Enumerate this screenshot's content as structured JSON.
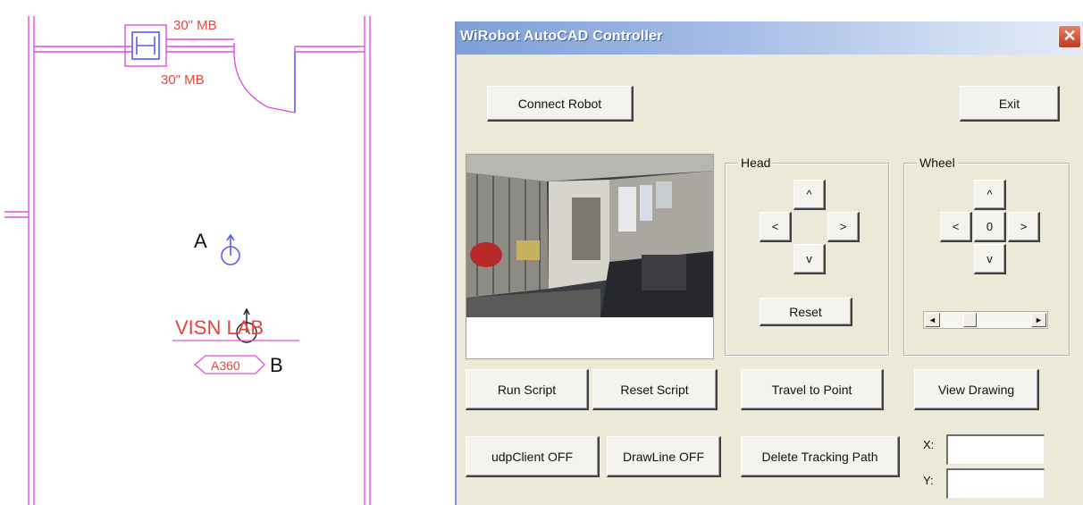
{
  "cad": {
    "mb_top": "30\" MB",
    "mb_bottom": "30\" MB",
    "point_a": "A",
    "point_b": "B",
    "room_name": "VISN LAB",
    "room_number": "A360",
    "wall_color": "#e04ee0",
    "marker_color": "#5a5af0"
  },
  "window": {
    "title": "WiRobot AutoCAD Controller",
    "close_glyph": "✕"
  },
  "buttons": {
    "connect": "Connect Robot",
    "exit": "Exit",
    "head_up": "^",
    "head_left": "<",
    "head_right": ">",
    "head_down": "v",
    "head_reset": "Reset",
    "wheel_up": "^",
    "wheel_left": "<",
    "wheel_center": "0",
    "wheel_right": ">",
    "wheel_down": "v",
    "run_script": "Run Script",
    "reset_script": "Reset Script",
    "travel_to_point": "Travel to Point",
    "view_drawing": "View Drawing",
    "udp_client": "udpClient OFF",
    "drawline": "DrawLine OFF",
    "delete_tracking": "Delete Tracking Path"
  },
  "groups": {
    "head_label": "Head",
    "wheel_label": "Wheel"
  },
  "scrollbar": {
    "left_arrow": "◄",
    "right_arrow": "►",
    "position_fraction": 0.3
  },
  "coords": {
    "x_label": "X:",
    "y_label": "Y:",
    "x_value": "",
    "y_value": ""
  }
}
